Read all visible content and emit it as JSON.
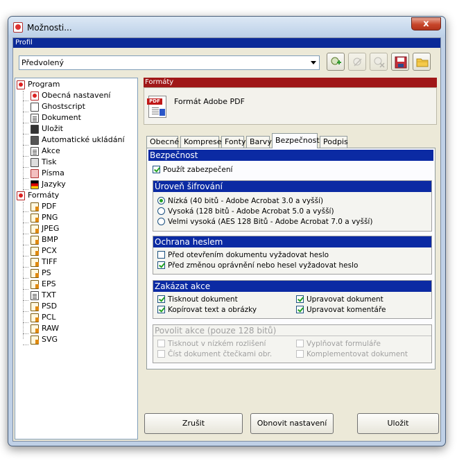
{
  "window": {
    "title": "Možnosti..."
  },
  "profile": {
    "header": "Profil",
    "selected": "Předvolený"
  },
  "tree": {
    "items": [
      {
        "label": "Program"
      },
      {
        "label": "Obecná nastavení"
      },
      {
        "label": "Ghostscript"
      },
      {
        "label": "Dokument"
      },
      {
        "label": "Uložit"
      },
      {
        "label": "Automatické ukládání"
      },
      {
        "label": "Akce"
      },
      {
        "label": "Tisk"
      },
      {
        "label": "Písma"
      },
      {
        "label": "Jazyky"
      },
      {
        "label": "Formáty"
      },
      {
        "label": "PDF"
      },
      {
        "label": "PNG"
      },
      {
        "label": "JPEG"
      },
      {
        "label": "BMP"
      },
      {
        "label": "PCX"
      },
      {
        "label": "TIFF"
      },
      {
        "label": "PS"
      },
      {
        "label": "EPS"
      },
      {
        "label": "TXT"
      },
      {
        "label": "PSD"
      },
      {
        "label": "PCL"
      },
      {
        "label": "RAW"
      },
      {
        "label": "SVG"
      }
    ]
  },
  "section": {
    "header": "Formáty",
    "format_name": "Formát Adobe PDF",
    "pdf_tag": "PDF"
  },
  "tabs": [
    {
      "label": "Obecné"
    },
    {
      "label": "Komprese"
    },
    {
      "label": "Fonty"
    },
    {
      "label": "Barvy"
    },
    {
      "label": "Bezpečnost"
    },
    {
      "label": "Podpis"
    }
  ],
  "security": {
    "header": "Bezpečnost",
    "use_security": "Použít zabezpečení",
    "encryption": {
      "header": "Úroveň šifrování",
      "options": [
        "Nízká (40 bitů - Adobe Acrobat 3.0 a vyšší)",
        "Vysoká (128 bitů - Adobe Acrobat 5.0 a vyšší)",
        "Velmi vysoká (AES 128 Bitů - Adobe Acrobat 7.0 a vyšší)"
      ]
    },
    "password": {
      "header": "Ochrana heslem",
      "open": "Před otevřením dokumentu vyžadovat heslo",
      "perm": "Před změnou oprávnění nebo hesel vyžadovat heslo"
    },
    "disallow": {
      "header": "Zakázat akce",
      "print": "Tisknout dokument",
      "copy": "Kopírovat text a obrázky",
      "modify": "Upravovat dokument",
      "comments": "Upravovat komentáře"
    },
    "allow": {
      "header": "Povolit akce (pouze 128 bitů)",
      "lowres": "Tisknout v nízkém rozlišení",
      "readers": "Číst dokument čtečkami obr.",
      "forms": "Vyplňovat formuláře",
      "assemble": "Komplementovat dokument"
    }
  },
  "buttons": {
    "cancel": "Zrušit",
    "reset": "Obnovit nastavení",
    "save": "Uložit"
  },
  "window_close": "x"
}
